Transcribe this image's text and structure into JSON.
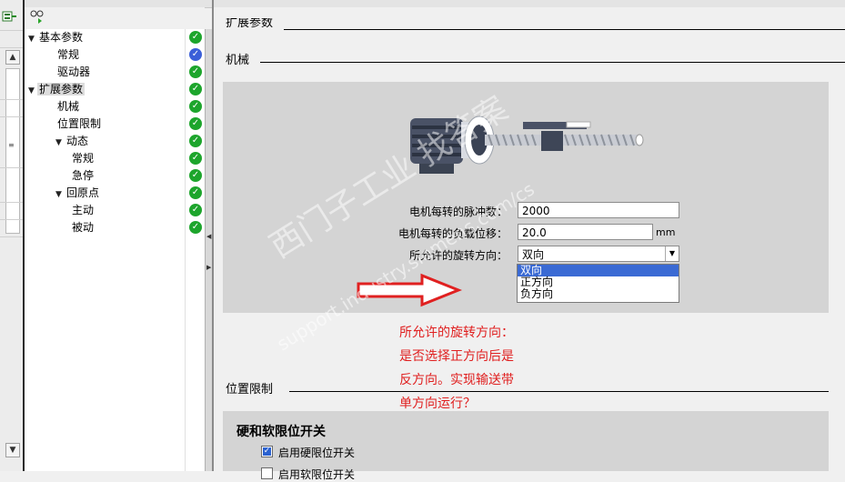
{
  "tree": {
    "items": [
      {
        "label": "基本参数",
        "level": 0,
        "arrow": "▼",
        "status": "ok"
      },
      {
        "label": "常规",
        "level": 1,
        "arrow": "",
        "status": "active"
      },
      {
        "label": "驱动器",
        "level": 1,
        "arrow": "",
        "status": "ok"
      },
      {
        "label": "扩展参数",
        "level": 0,
        "arrow": "▼",
        "status": "ok",
        "selected": true
      },
      {
        "label": "机械",
        "level": 1,
        "arrow": "",
        "status": "ok"
      },
      {
        "label": "位置限制",
        "level": 1,
        "arrow": "",
        "status": "ok"
      },
      {
        "label": "动态",
        "level": 1,
        "arrow": "▼",
        "status": "ok"
      },
      {
        "label": "常规",
        "level": 2,
        "arrow": "",
        "status": "ok"
      },
      {
        "label": "急停",
        "level": 2,
        "arrow": "",
        "status": "ok"
      },
      {
        "label": "回原点",
        "level": 1,
        "arrow": "▼",
        "status": "ok"
      },
      {
        "label": "主动",
        "level": 2,
        "arrow": "",
        "status": "ok"
      },
      {
        "label": "被动",
        "level": 2,
        "arrow": "",
        "status": "ok"
      }
    ]
  },
  "sections": {
    "top_partial": "扩展参数",
    "mechanics": "机械",
    "position_limits": "位置限制"
  },
  "mechanics": {
    "pulses_label": "电机每转的脉冲数：",
    "pulses_value": "2000",
    "load_label": "电机每转的负载位移：",
    "load_value": "20.0",
    "load_unit": "mm",
    "direction_label": "所允许的旋转方向：",
    "direction_value": "双向",
    "direction_options": [
      "双向",
      "正方向",
      "负方向"
    ]
  },
  "annotation": {
    "lines": [
      "所允许的旋转方向：",
      "是否选择正方向后是",
      "反方向。实现输送带",
      "单方向运行？"
    ],
    "color": "#e02020"
  },
  "limits": {
    "heading": "硬和软限位开关",
    "hw_checkbox": "启用硬限位开关",
    "hw_checked": true,
    "sw_checkbox": "启用软限位开关",
    "sw_checked": false
  },
  "watermark": {
    "line1": "西门子工业  找答案",
    "line2": "support.industry.siemens.com/cs"
  },
  "icons": {
    "toolbar": [
      "network-icon",
      "device-view-icon"
    ],
    "status_ok": "check-circle-icon",
    "status_active": "check-circle-blue-icon"
  }
}
